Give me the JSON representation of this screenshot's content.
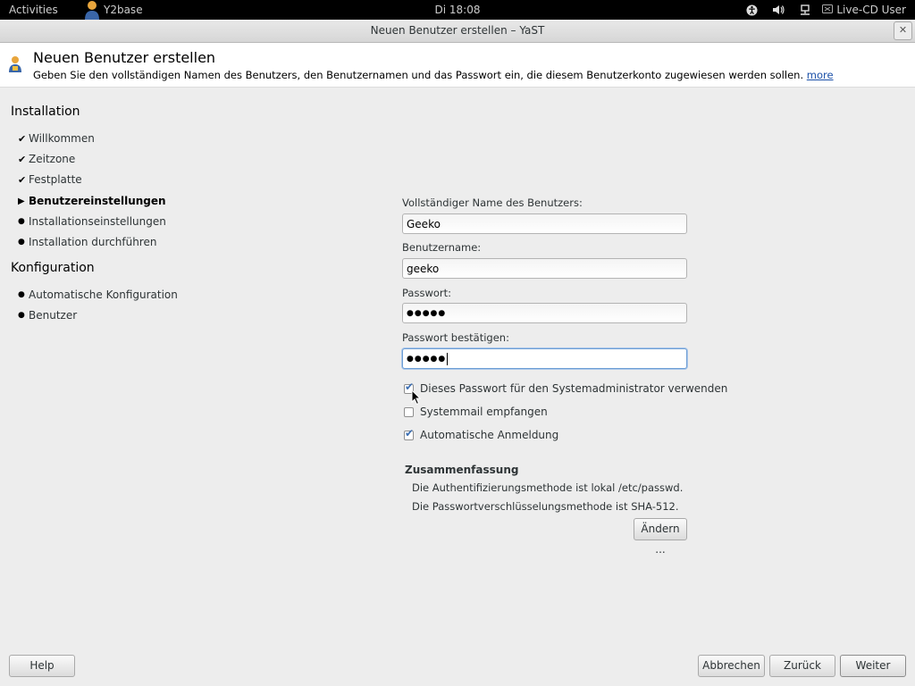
{
  "topbar": {
    "activities": "Activities",
    "app_name": "Y2base",
    "clock": "Di 18:08",
    "user": "Live-CD User"
  },
  "window": {
    "title": "Neuen Benutzer erstellen – YaST",
    "close_glyph": "✕"
  },
  "header": {
    "title": "Neuen Benutzer erstellen",
    "description": "Geben Sie den vollständigen Namen des Benutzers, den Benutzernamen und das Passwort ein, die diesem Benutzerkonto zugewiesen werden sollen.",
    "more_link": "more"
  },
  "steps": {
    "installation_title": "Installation",
    "installation": [
      {
        "label": "Willkommen",
        "state": "done",
        "marker": "✔"
      },
      {
        "label": "Zeitzone",
        "state": "done",
        "marker": "✔"
      },
      {
        "label": "Festplatte",
        "state": "done",
        "marker": "✔"
      },
      {
        "label": "Benutzereinstellungen",
        "state": "current",
        "marker": "▶"
      },
      {
        "label": "Installationseinstellungen",
        "state": "todo",
        "marker": "●"
      },
      {
        "label": "Installation durchführen",
        "state": "todo",
        "marker": "●"
      }
    ],
    "config_title": "Konfiguration",
    "configuration": [
      {
        "label": "Automatische Konfiguration",
        "state": "todo",
        "marker": "●"
      },
      {
        "label": "Benutzer",
        "state": "todo",
        "marker": "●"
      }
    ]
  },
  "form": {
    "fullname_label": "Vollständiger Name des Benutzers:",
    "fullname_value": "Geeko",
    "username_label": "Benutzername:",
    "username_value": "geeko",
    "password_label": "Passwort:",
    "password_value": "●●●●●",
    "confirm_label": "Passwort bestätigen:",
    "confirm_value": "●●●●●",
    "checkboxes": [
      {
        "label": "Dieses Passwort für den Systemadministrator verwenden",
        "checked": true
      },
      {
        "label": "Systemmail empfangen",
        "checked": false
      },
      {
        "label": "Automatische Anmeldung",
        "checked": true
      }
    ]
  },
  "summary": {
    "title": "Zusammenfassung",
    "lines": [
      "Die Authentifizierungsmethode ist lokal /etc/passwd.",
      "Die Passwortverschlüsselungsmethode ist SHA-512."
    ],
    "change_button": "Ändern ..."
  },
  "footer": {
    "help": "Help",
    "abort": "Abbrechen",
    "back": "Zurück",
    "next": "Weiter"
  },
  "colors": {
    "topbar_bg": "#000000",
    "link": "#1b50a8",
    "focus": "#6f9fd5"
  }
}
